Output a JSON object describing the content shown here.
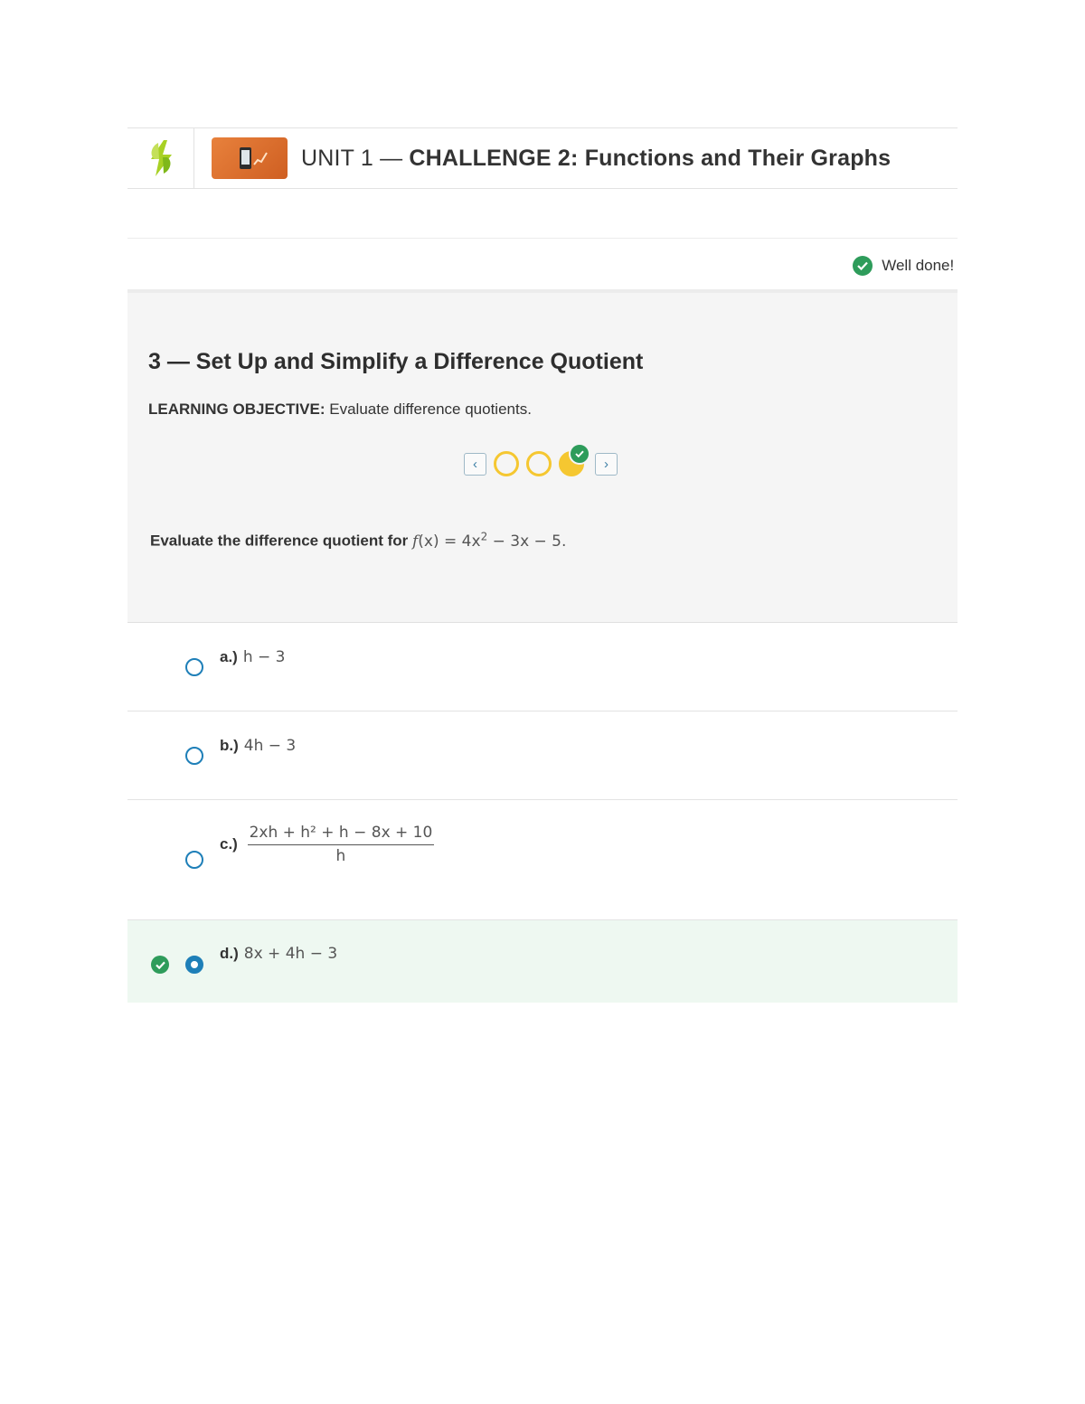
{
  "header": {
    "title_prefix": "UNIT 1 — ",
    "title_main": "CHALLENGE 2: Functions and Their Graphs"
  },
  "status": {
    "message": "Well done! Y"
  },
  "question": {
    "title": "3 — Set Up and Simplify a Difference Quotient",
    "objective_label": "LEARNING OBJECTIVE:",
    "objective_text": " Evaluate difference quotients.",
    "prompt_label": "Evaluate the difference quotient for ",
    "pager": {
      "prev": "‹",
      "next": "›",
      "dots": [
        "empty",
        "empty",
        "filled-correct"
      ]
    }
  },
  "options": [
    {
      "letter": "a.)",
      "expr": "h − 3"
    },
    {
      "letter": "b.)",
      "expr": "4h − 3"
    },
    {
      "letter": "c.)",
      "numerator": "2xh + h² + h − 8x + 10",
      "denominator": "h"
    },
    {
      "letter": "d.)",
      "expr": "8x + 4h − 3",
      "selected": true,
      "correct": true
    }
  ],
  "colors": {
    "accent_blue": "#1e7fb8",
    "success_green": "#2e9c5b",
    "progress_yellow": "#f5c731",
    "brand_orange": "#e8813c",
    "logo_green": "#9fcf1f"
  }
}
